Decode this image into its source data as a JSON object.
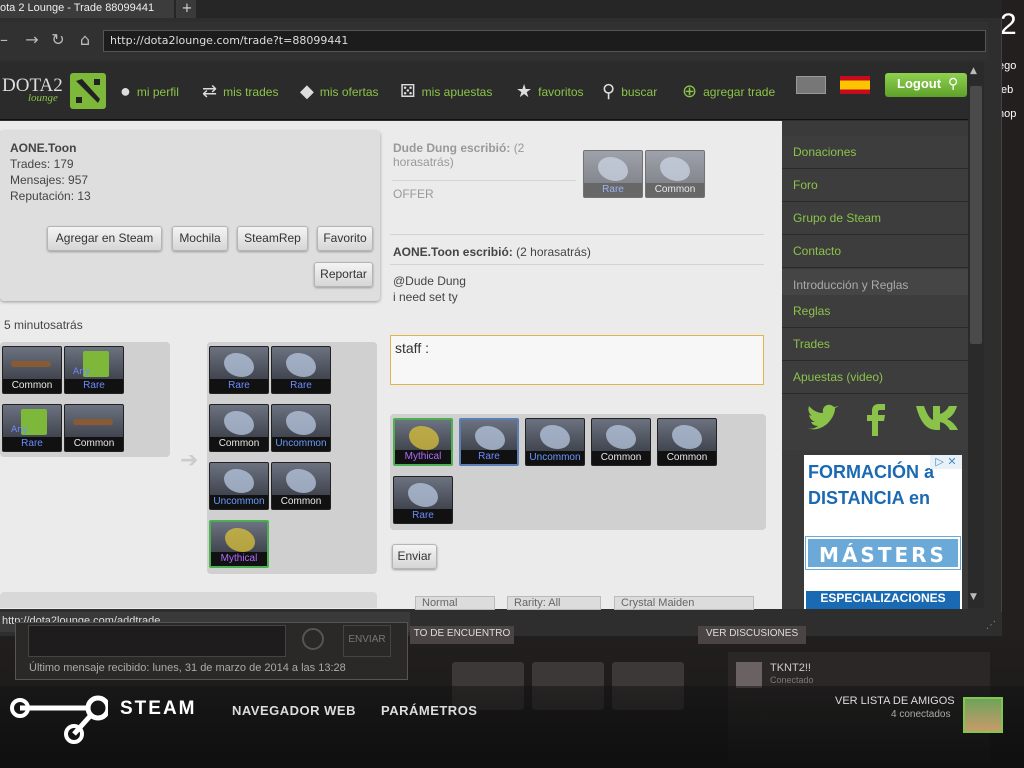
{
  "browser": {
    "tab_title": "ota 2 Lounge - Trade 88099441",
    "tab_close": "×",
    "new_tab": "+",
    "url": "http://dota2lounge.com/trade?t=88099441",
    "status_url": "http://dota2lounge.com/addtrade"
  },
  "right_edge": {
    "big": "2",
    "lines": [
      "ego",
      "/eb",
      "hop"
    ]
  },
  "header": {
    "logo_text": "DOTA2",
    "logo_sub": "lounge",
    "nav": [
      {
        "icon": "person-icon",
        "label": "mi perfil"
      },
      {
        "icon": "trades-icon",
        "label": "mis trades"
      },
      {
        "icon": "tag-icon",
        "label": "mis ofertas"
      },
      {
        "icon": "dice-icon",
        "label": "mis apuestas"
      },
      {
        "icon": "star-icon",
        "label": "favoritos"
      },
      {
        "icon": "search-icon",
        "label": "buscar"
      },
      {
        "icon": "plus-circle-icon",
        "label": "agregar trade"
      }
    ],
    "logout_label": "Logout"
  },
  "profile": {
    "name": "AONE.Toon",
    "trades": "Trades: 179",
    "mensajes": "Mensajes: 957",
    "reputacion": "Reputación: 13",
    "buttons": {
      "steam": "Agregar en Steam",
      "mochila": "Mochila",
      "steamrep": "SteamRep",
      "favorito": "Favorito",
      "reportar": "Reportar"
    }
  },
  "trade": {
    "time": "5 minutosatrás",
    "offer_items": [
      {
        "kind": "key",
        "rarity": "Common"
      },
      {
        "kind": "dota",
        "rarity": "Rare",
        "sub": "Any"
      },
      {
        "kind": "dota",
        "rarity": "Rare",
        "sub": "Any"
      },
      {
        "kind": "key",
        "rarity": "Common"
      }
    ],
    "want_items": [
      {
        "rarity": "Rare"
      },
      {
        "rarity": "Rare"
      },
      {
        "rarity": "Common"
      },
      {
        "rarity": "Uncommon"
      },
      {
        "rarity": "Uncommon"
      },
      {
        "rarity": "Common"
      },
      {
        "rarity": "Mythical"
      }
    ]
  },
  "comments": [
    {
      "author": "Dude Dung escribió:",
      "when": "(2 horasatrás)",
      "text": "OFFER",
      "items": [
        "Rare",
        "Common"
      ]
    },
    {
      "author": "AONE.Toon escribió:",
      "when": "(2 horasatrás)",
      "line1": "@Dude Dung",
      "line2": "i need set ty"
    }
  ],
  "reply": {
    "value": "staff :",
    "items": [
      "Mythical",
      "Rare",
      "Uncommon",
      "Common",
      "Common",
      "Rare"
    ],
    "send_label": "Enviar"
  },
  "filters": [
    "Normal",
    "Rarity: All",
    "Crystal Maiden"
  ],
  "sidebar": {
    "items": [
      "Donaciones",
      "Foro",
      "Grupo de Steam",
      "Contacto"
    ],
    "section": "Introducción y Reglas",
    "items2": [
      "Reglas",
      "Trades",
      "Apuestas (video)"
    ],
    "social": [
      "twitter-icon",
      "facebook-icon",
      "vk-icon"
    ]
  },
  "ad": {
    "line1": "FORMACIÓN a",
    "line2": "DISTANCIA en",
    "line3": "MÁSTERS",
    "line4": "ESPECIALIZACIONES"
  },
  "chat": {
    "send": "ENVIAR",
    "last": "Último mensaje recibido: lunes, 31 de marzo de 2014 a las 13:28",
    "btn1": "TO DE ENCUENTRO",
    "btn2": "VER DISCUSIONES"
  },
  "friends": {
    "name": "TKNT2!!",
    "status": "Conectado",
    "list_label": "VER LISTA DE AMIGOS",
    "count": "4 conectados"
  },
  "steam": {
    "title": "STEAM",
    "nav1": "NAVEGADOR WEB",
    "nav2": "PARÁMETROS"
  },
  "colors": {
    "accent": "#8bc34a",
    "page_bg": "#ebebeb",
    "header_bg": "#2b2b2b"
  }
}
